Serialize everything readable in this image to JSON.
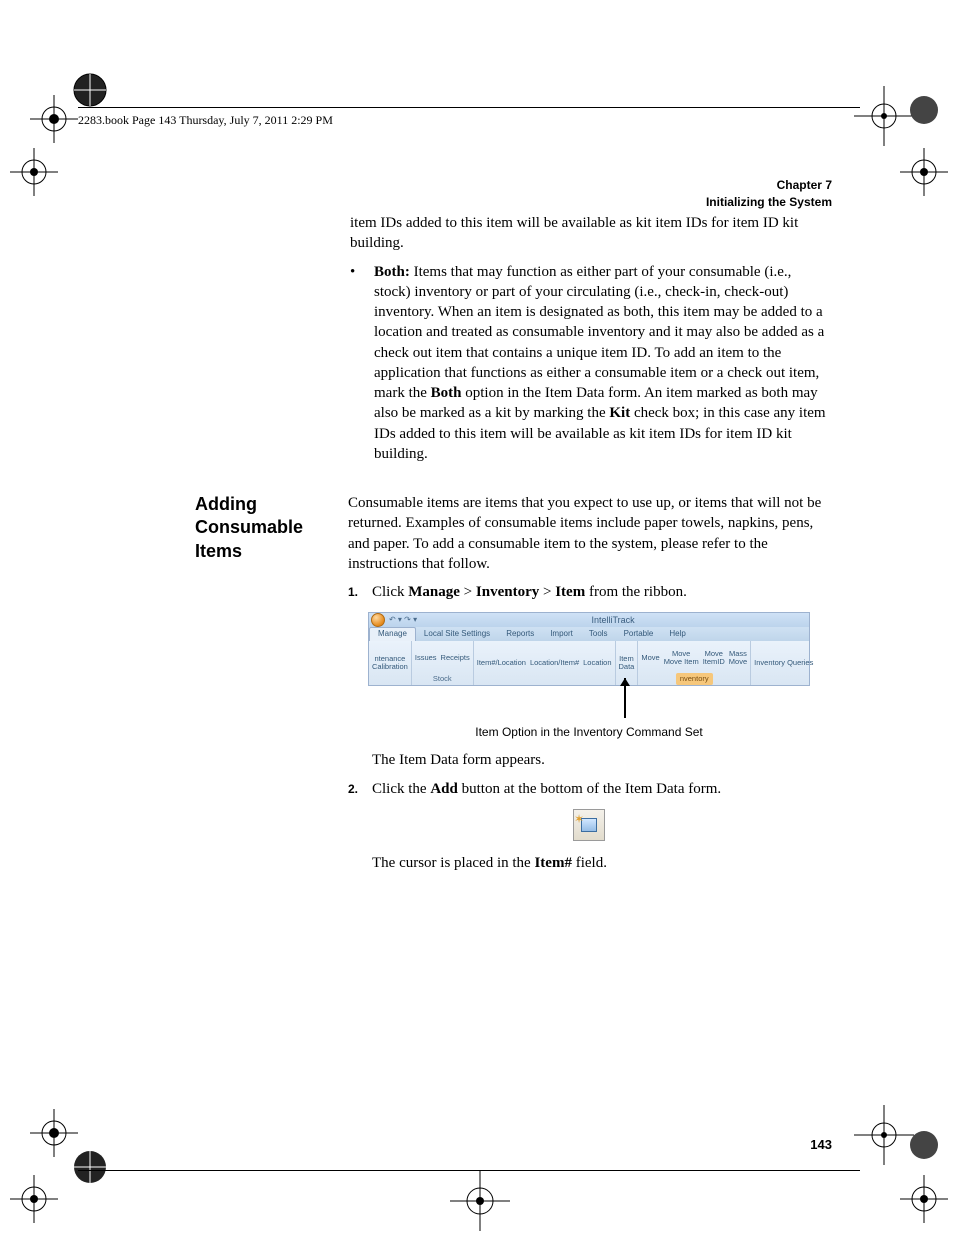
{
  "header": {
    "running_head": "2283.book  Page 143  Thursday, July 7, 2011  2:29 PM",
    "chapter_label": "Chapter 7",
    "chapter_title": "Initializing the System"
  },
  "intro_fragment": "item IDs added to this item will be available as kit item IDs for item ID kit building.",
  "bullet": {
    "label": "Both:",
    "text_before": " Items that may function as either part of your consumable (i.e., stock) inventory or part of your circulating (i.e., check-in, check-out) inventory. When an item is designated as both, this item may be added to a location and treated as consumable inventory and it may also be added as a check out item that contains a unique item ID. To add an item to the application that functions as either a consumable item or a check out item, mark the ",
    "bold1": "Both",
    "text_mid": " option in the Item Data form. An item marked as both may also be marked as a kit by marking the ",
    "bold2": "Kit",
    "text_after": " check box; in this case any item IDs added to this item will be available as kit item IDs for item ID kit building."
  },
  "side_heading": "Adding Consumable Items",
  "sec2_intro": "Consumable items are items that you expect to use up, or items that will not be returned. Examples of consumable items include paper towels, napkins, pens, and paper. To add a consumable item to the system, please refer to the instructions that follow.",
  "step1": {
    "n": "1.",
    "pre": "Click ",
    "b1": "Manage",
    "sep1": " > ",
    "b2": "Inventory",
    "sep2": " > ",
    "b3": "Item",
    "post": " from the ribbon."
  },
  "figure": {
    "app_title": "IntelliTrack",
    "qat": "↶ ▾ ↷   ▾",
    "tabs": [
      "Manage",
      "Local Site Settings",
      "Reports",
      "Import",
      "Tools",
      "Portable",
      "Help"
    ],
    "groups": {
      "g1": {
        "cmds": [
          "ntenance\nCalibration"
        ],
        "label": ""
      },
      "g2": {
        "cmds": [
          "Issues",
          "Receipts"
        ],
        "label": "Stock"
      },
      "g3": {
        "cmds": [
          "Item#/Location",
          "Location/Item#",
          "Location"
        ],
        "label": ""
      },
      "g4": {
        "cmds": [
          "Item\nData"
        ],
        "label": ""
      },
      "g5": {
        "cmds": [
          "Move",
          "Move\nMove Item",
          "Move\nItemID",
          "Mass\nMove"
        ],
        "label": "nventory"
      },
      "g6": {
        "cmds": [
          "Inventory Queries"
        ],
        "label": ""
      }
    },
    "caption": "Item Option in the Inventory Command Set"
  },
  "after_fig1": "The Item Data form appears.",
  "step2": {
    "n": "2.",
    "pre": "Click the ",
    "b1": "Add",
    "post": " button at the bottom of the Item Data form."
  },
  "after_fig2_pre": "The cursor is placed in the ",
  "after_fig2_bold": "Item#",
  "after_fig2_post": " field.",
  "page_number": "143"
}
